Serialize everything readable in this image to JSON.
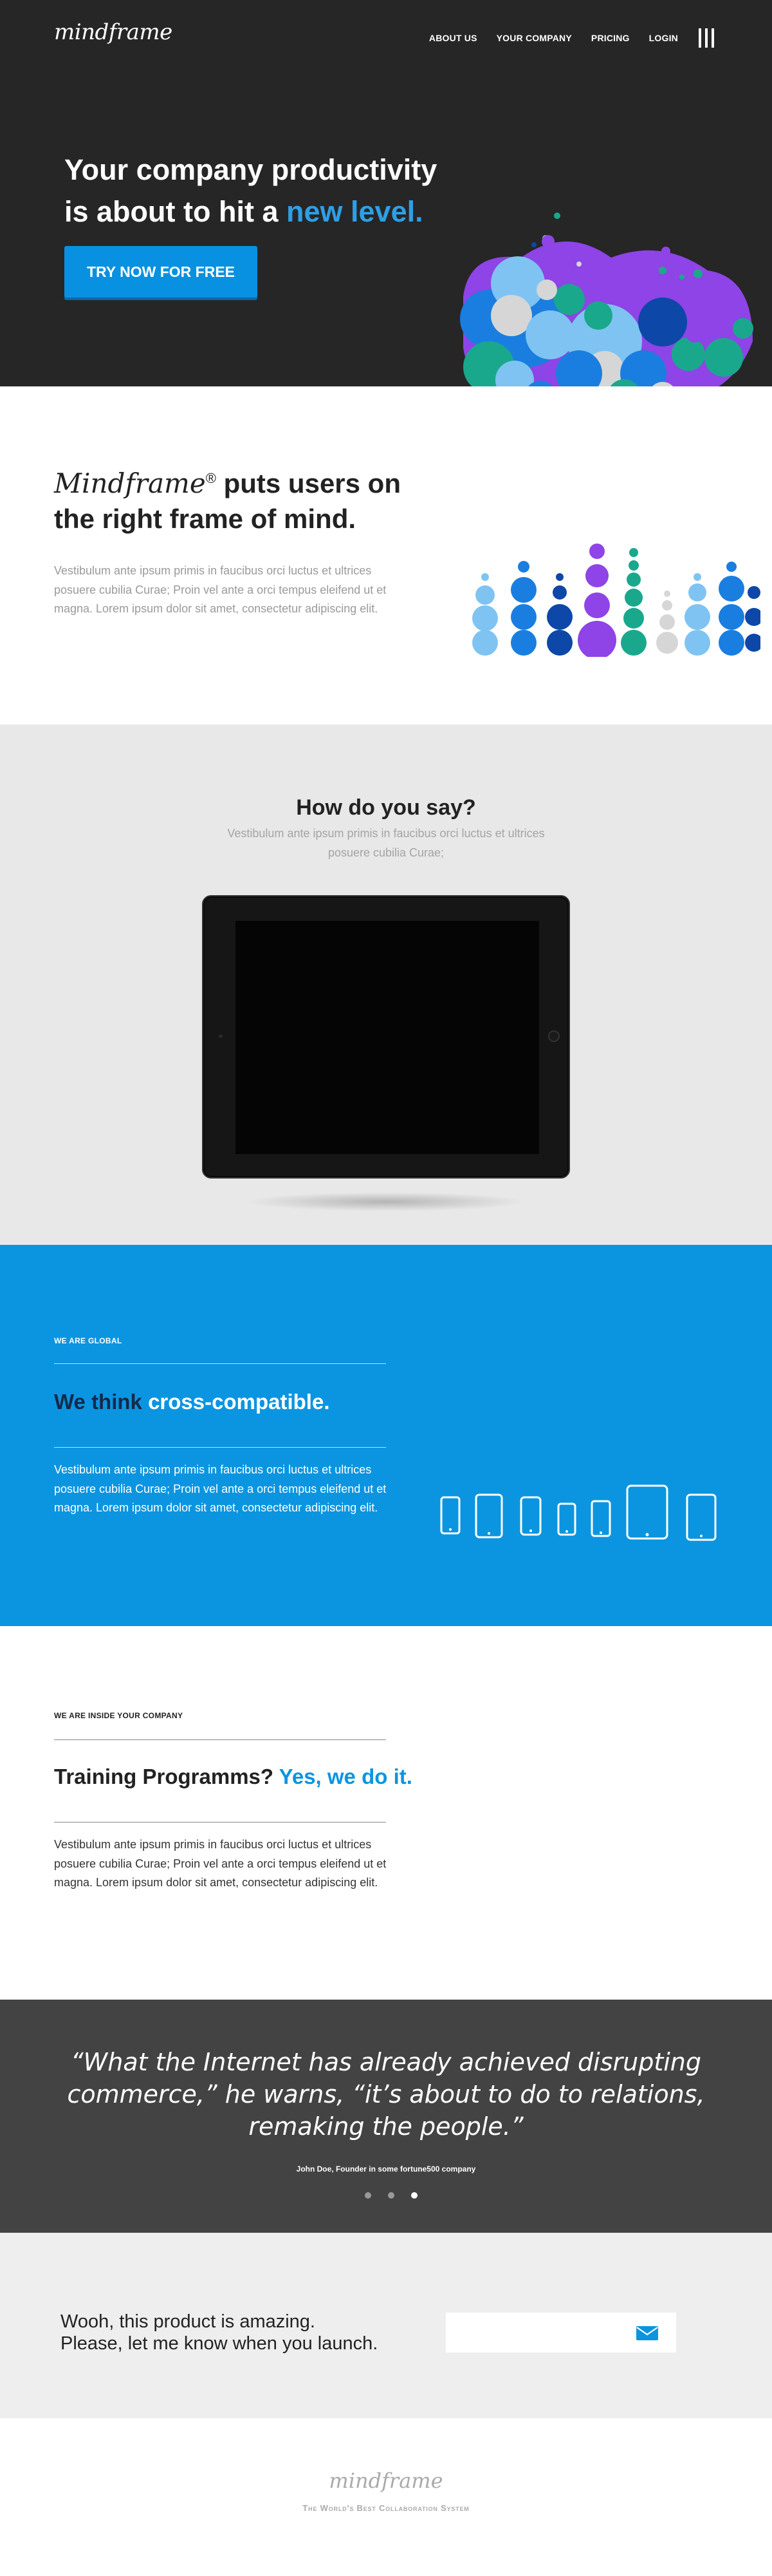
{
  "header": {
    "logo": "mindframe",
    "nav": [
      "ABOUT US",
      "YOUR COMPANY",
      "PRICING",
      "LOGIN"
    ],
    "menu_icon": "hamburger-menu-icon"
  },
  "hero": {
    "title_line1": "Your company productivity",
    "title_line2_start": "is about to hit a ",
    "title_highlight": "new level.",
    "cta_label": "TRY NOW FOR FREE"
  },
  "intro": {
    "brand": "Mindframe",
    "registered": "®",
    "title_rest_1": " puts users on",
    "title_rest_2": "the right frame of mind.",
    "body": "Vestibulum ante ipsum primis in faucibus orci luctus et ultrices posuere cubilia Curae; Proin vel ante a orci tempus eleifend ut et magna. Lorem ipsum dolor sit amet, consectetur adipiscing elit."
  },
  "how": {
    "title": "How do you say?",
    "subtitle": "Vestibulum ante ipsum primis in faucibus orci luctus et ultrices posuere cubilia Curae;"
  },
  "global": {
    "eyebrow": "WE ARE GLOBAL",
    "title_start": "We think ",
    "title_highlight": "cross-compatible.",
    "body": "Vestibulum ante ipsum primis in faucibus orci luctus et ultrices posuere cubilia Curae; Proin vel ante a orci tempus eleifend ut et magna. Lorem ipsum dolor sit amet, consectetur adipiscing elit."
  },
  "training": {
    "eyebrow": "WE ARE INSIDE YOUR COMPANY",
    "title_start": "Training Programms? ",
    "title_highlight": "Yes, we do it.",
    "body": "Vestibulum ante ipsum primis in faucibus orci luctus et ultrices posuere cubilia Curae; Proin vel ante a orci tempus eleifend ut et magna. Lorem ipsum dolor sit amet, consectetur adipiscing elit."
  },
  "quote": {
    "text": "“What the Internet has already achieved disrupting commerce,” he warns, “it’s about to do to relations, remaking the people.”",
    "cite": "John Doe, Founder in some fortune500 company",
    "pages": 3,
    "active_page": 3
  },
  "signup": {
    "message_line1": "Wooh, this product is amazing.",
    "message_line2": "Please, let me know when you launch.",
    "email_placeholder": "",
    "send_icon": "envelope-icon"
  },
  "footer": {
    "logo": "mindframe",
    "tagline": "The World's Best Collaboration System"
  },
  "colors": {
    "accent": "#0b95e0",
    "dark": "#262626",
    "light_blue": "#7fc3f2",
    "mid_blue": "#1a7ee0",
    "navy": "#0d47a8",
    "purple": "#8e44e6",
    "teal": "#1aa88c",
    "grey": "#d6d6d6"
  }
}
